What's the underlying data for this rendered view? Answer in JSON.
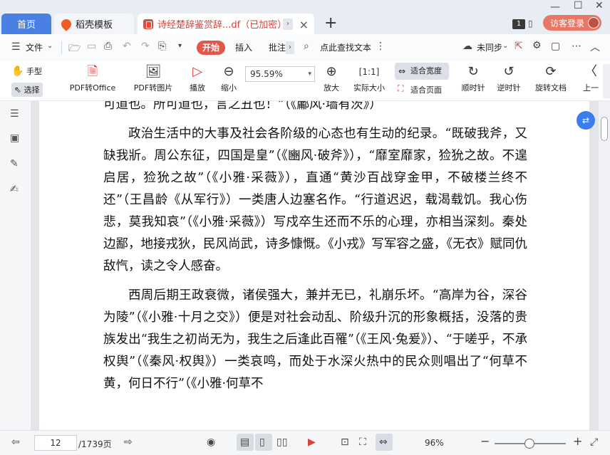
{
  "tabs": {
    "home": "首页",
    "template": "稻壳模板",
    "doc": "诗经楚辞鉴赏辞...df（已加密）",
    "count_badge": "1",
    "login": "访客登录"
  },
  "menubar": {
    "file": "文件",
    "start": "开始",
    "insert": "插入",
    "annotate": "批注",
    "search": "点此查找文本",
    "sync": "未同步"
  },
  "ribbon": {
    "hand": "手型",
    "select": "选择",
    "pdf_to_office": "PDF转Office",
    "pdf_to_image": "PDF转图片",
    "play": "播放",
    "zoom_out": "缩小",
    "zoom_value": "95.59%",
    "zoom_in": "放大",
    "actual_size": "实际大小",
    "fit_width": "适合宽度",
    "fit_page": "适合页面",
    "rotate_cw": "顺时针",
    "rotate_ccw": "逆时针",
    "rotate_doc": "旋转文档",
    "prev": "上一"
  },
  "document": {
    "p0": "可道也。所可道也，言之丑也！”（《鄘风·墙有茨》）",
    "p1": "政治生活中的大事及社会各阶级的心态也有生动的纪录。“既破我斧，又缺我斨。周公东征，四国是皇”（《豳风·破斧》），“靡室靡家，猃狁之故。不遑启居，猃狁之故”（《小雅·采薇》），直通“黄沙百战穿金甲，不破楼兰终不还”（王昌龄《从军行》）一类唐人边塞名作。“行道迟迟，载渴载饥。我心伤悲，莫我知哀”（《小雅·采薇》）写戍卒生还而不乐的心理，亦相当深刻。秦处边鄙，地接戎狄，民风尚武，诗多慷慨。《小戎》写军容之盛，《无衣》赋同仇敌忾，读之令人感奋。",
    "p2": "西周后期王政衰微，诸侯强大，兼并无已，礼崩乐坏。“高岸为谷，深谷为陵”（《小雅·十月之交》）便是对社会动乱、阶级升沉的形象概括，没落的贵族发出“我生之初尚无为，我生之后逢此百罹”（《王风·兔爰》）、“于嗟乎，不承权舆”（《秦风·权舆》）一类哀鸣，而处于水深火热中的民众则唱出了“何草不黄，何日不行”（《小雅·何草不"
  },
  "statusbar": {
    "page": "12",
    "total": "/1739页",
    "zoom": "96%"
  }
}
